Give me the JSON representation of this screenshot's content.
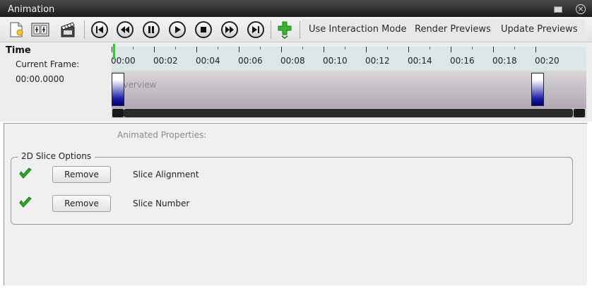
{
  "window": {
    "title": "Animation"
  },
  "toolbar": {
    "tools": [
      {
        "name": "new-animation",
        "icon": "new-document-icon"
      },
      {
        "name": "keyframe-editor",
        "icon": "keyframe-editor-icon"
      },
      {
        "name": "record-movie",
        "icon": "movie-clapper-icon"
      }
    ],
    "playback": [
      {
        "name": "first-frame",
        "icon": "skip-to-start-icon"
      },
      {
        "name": "previous-frame",
        "icon": "rewind-icon"
      },
      {
        "name": "pause",
        "icon": "pause-icon"
      },
      {
        "name": "play",
        "icon": "play-icon"
      },
      {
        "name": "stop",
        "icon": "stop-icon"
      },
      {
        "name": "next-frame",
        "icon": "fast-forward-icon"
      },
      {
        "name": "last-frame",
        "icon": "skip-to-end-icon"
      }
    ],
    "add_icon": "green-plus-icon",
    "interaction_mode_label": "Use Interaction Mode",
    "render_previews_label": "Render Previews",
    "update_previews_label": "Update Previews"
  },
  "timeline": {
    "time_label": "Time",
    "current_frame_label": "Current Frame:",
    "current_frame_value": "00:00.0000",
    "overview_label": "Overview",
    "ticks": [
      "00:00",
      "00:02",
      "00:04",
      "00:06",
      "00:08",
      "00:10",
      "00:12",
      "00:14",
      "00:16",
      "00:18",
      "00:20"
    ]
  },
  "properties": {
    "header": "Animated Properties:",
    "group_title": "2D Slice Options",
    "items": [
      {
        "checked": true,
        "remove_label": "Remove",
        "name": "Slice Alignment"
      },
      {
        "checked": true,
        "remove_label": "Remove",
        "name": "Slice Number"
      }
    ]
  },
  "colors": {
    "accent_green": "#2ecb2e",
    "keyframe_blue": "#1a1aa8",
    "titlebar": "#2a2a2a"
  }
}
